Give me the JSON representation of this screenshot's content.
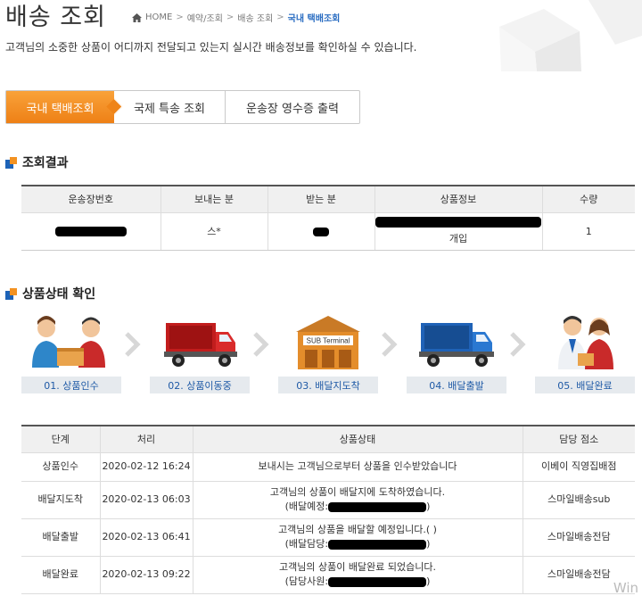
{
  "header": {
    "title": "배송 조회",
    "breadcrumb": [
      "HOME",
      "예약/조회",
      "배송 조회",
      "국내 택배조회"
    ]
  },
  "subtitle": "고객님의 소중한 상품이 어디까지 전달되고 있는지 실시간 배송정보를 확인하실 수 있습니다.",
  "tabs": [
    {
      "label": "국내 택배조회",
      "active": true
    },
    {
      "label": "국제 특송 조회",
      "active": false
    },
    {
      "label": "운송장 영수증 출력",
      "active": false
    }
  ],
  "result": {
    "section_title": "조회결과",
    "columns": [
      "운송장번호",
      "보내는 분",
      "받는 분",
      "상품정보",
      "수량"
    ],
    "row": {
      "sender": "스*",
      "product_sub": "개입",
      "quantity": "1"
    }
  },
  "status_section": {
    "section_title": "상품상태 확인",
    "steps": [
      {
        "label": "01. 상품인수",
        "icon": "handover-icon"
      },
      {
        "label": "02. 상품이동중",
        "icon": "truck-icon"
      },
      {
        "label": "03. 배달지도착",
        "icon": "terminal-icon",
        "sign": "SUB Terminal"
      },
      {
        "label": "04. 배달출발",
        "icon": "delivery-truck-icon"
      },
      {
        "label": "05. 배달완료",
        "icon": "delivered-icon"
      }
    ]
  },
  "status_table": {
    "columns": [
      "단계",
      "처리",
      "상품상태",
      "담당 점소"
    ],
    "rows": [
      {
        "stage": "상품인수",
        "time": "2020-02-12 16:24",
        "msg": "보내시는 고객님으로부터 상품을 인수받았습니다",
        "sub": "",
        "branch": "이베이 직영집배점"
      },
      {
        "stage": "배달지도착",
        "time": "2020-02-13 06:03",
        "msg": "고객님의 상품이 배달지에 도착하였습니다.",
        "sub": "(배달예정:",
        "branch": "스마일배송sub"
      },
      {
        "stage": "배달출발",
        "time": "2020-02-13 06:41",
        "msg": "고객님의 상품을 배달할 예정입니다.( )",
        "sub": "(배달담당:",
        "branch": "스마일배송전담"
      },
      {
        "stage": "배달완료",
        "time": "2020-02-13 09:22",
        "msg": "고객님의 상품이 배달완료 되었습니다.",
        "sub": "(담당사원:",
        "branch": "스마일배송전담"
      }
    ]
  },
  "watermark": "Win",
  "colors": {
    "accent": "#ef8418",
    "link": "#2a6dc2",
    "step_label": "#1f5aa6"
  }
}
